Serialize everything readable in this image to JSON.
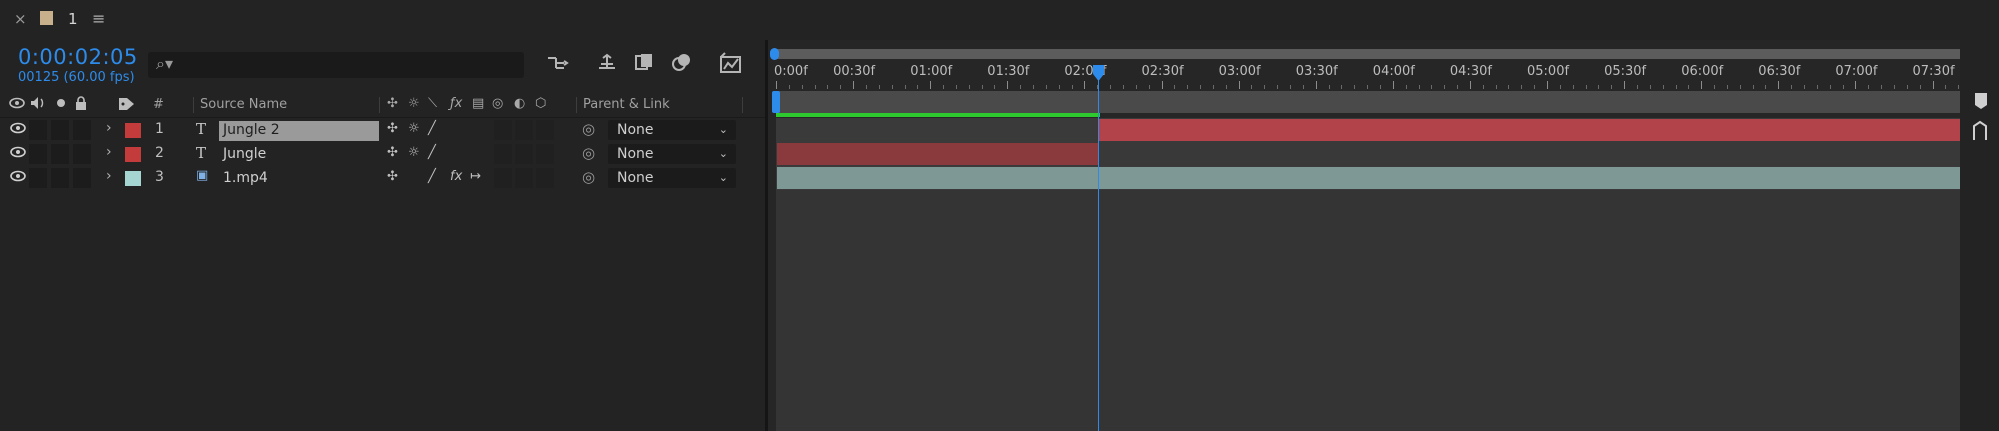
{
  "tab": {
    "close": "×",
    "title": "1",
    "menu": "≡"
  },
  "header": {
    "timecode": "0:00:02:05",
    "frames": "00125 (60.00 fps)",
    "search_glyph": "⌕▾",
    "search_placeholder": ""
  },
  "columns": {
    "number": "#",
    "source_name": "Source Name",
    "parent_link": "Parent & Link"
  },
  "layers": [
    {
      "num": "1",
      "type": "T",
      "name": "Jungle 2",
      "color": "#c33b3b",
      "parent": "None",
      "selected": true,
      "switches": [
        "✣",
        "☼",
        "╱"
      ]
    },
    {
      "num": "2",
      "type": "T",
      "name": "Jungle",
      "color": "#c33b3b",
      "parent": "None",
      "selected": false,
      "switches": [
        "✣",
        "☼",
        "╱"
      ]
    },
    {
      "num": "3",
      "type": "▣",
      "name": "1.mp4",
      "color": "#a6d6d2",
      "parent": "None",
      "selected": false,
      "switches": [
        "✣",
        "╱",
        "fx",
        "↦"
      ]
    }
  ],
  "ruler": {
    "labels": [
      "0:00f",
      "00:30f",
      "01:00f",
      "01:30f",
      "02:00f",
      "02:30f",
      "03:00f",
      "03:30f",
      "04:00f",
      "04:30f",
      "05:00f",
      "05:30f",
      "06:00f",
      "06:30f",
      "07:00f",
      "07:30f"
    ]
  },
  "colors": {
    "accent": "#2d8ceb",
    "bar_red": "#b3434a",
    "bar_red_dark": "#8a3a3c",
    "bar_teal": "#7e9896",
    "render_green": "#2ec92e"
  },
  "icons": {
    "eye": "👁",
    "audio": "🔊",
    "solo": "●",
    "lock": "🔒",
    "label": "🏷",
    "chevron": "›",
    "spiral": "◎",
    "dropdown": "⌄"
  }
}
